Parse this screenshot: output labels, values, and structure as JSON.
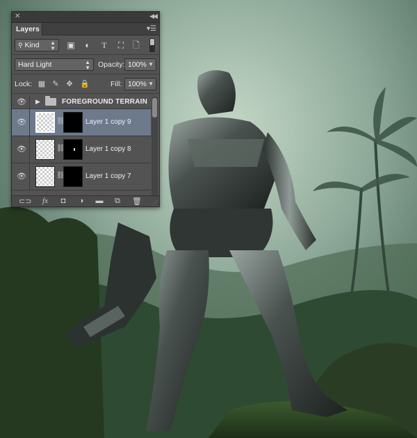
{
  "panel": {
    "title": "Layers",
    "filter": {
      "label": "Kind"
    },
    "blend_mode": "Hard Light",
    "opacity_label": "Opacity:",
    "opacity_value": "100%",
    "lock_label": "Lock:",
    "fill_label": "Fill:",
    "fill_value": "100%"
  },
  "layers": [
    {
      "type": "group",
      "name": "FOREGROUND TERRAIN",
      "visible": true,
      "selected": false
    },
    {
      "type": "layer",
      "name": "Layer 1 copy 9",
      "visible": true,
      "selected": true
    },
    {
      "type": "layer",
      "name": "Layer 1 copy 8",
      "visible": true,
      "selected": false
    },
    {
      "type": "layer",
      "name": "Layer 1 copy 7",
      "visible": true,
      "selected": false
    }
  ],
  "icons": {
    "filter_icons": [
      "image-filter-icon",
      "adjustment-filter-icon",
      "type-filter-icon",
      "shape-filter-icon",
      "smart-object-filter-icon"
    ],
    "lock_icons": [
      "lock-transparent-icon",
      "lock-image-icon",
      "lock-position-icon",
      "lock-all-icon"
    ],
    "bottom_icons": [
      "link-layers-icon",
      "fx-icon",
      "add-mask-icon",
      "adjustment-layer-icon",
      "new-group-icon",
      "new-layer-icon",
      "trash-icon"
    ]
  },
  "colors": {
    "panel_bg": "#535353",
    "selected_row": "#6d7a8c",
    "sky": "#a9c3b2"
  }
}
